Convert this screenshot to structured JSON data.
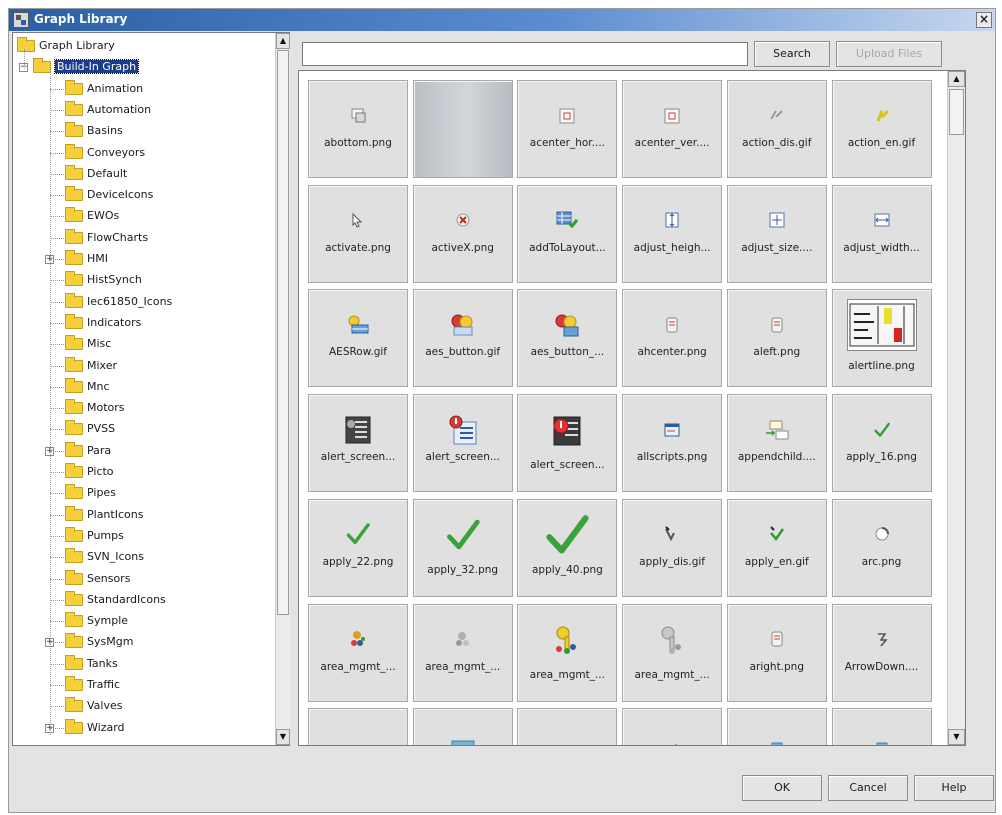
{
  "window": {
    "title": "Graph Library",
    "close_glyph": "×"
  },
  "tree": {
    "items": [
      {
        "label": "Graph Library",
        "depth": 0,
        "expander": "",
        "selected": false
      },
      {
        "label": "Build-In Graph",
        "depth": 1,
        "expander": "−",
        "selected": true
      },
      {
        "label": "Animation",
        "depth": 2,
        "expander": "",
        "selected": false
      },
      {
        "label": "Automation",
        "depth": 2,
        "expander": "",
        "selected": false
      },
      {
        "label": "Basins",
        "depth": 2,
        "expander": "",
        "selected": false
      },
      {
        "label": "Conveyors",
        "depth": 2,
        "expander": "",
        "selected": false
      },
      {
        "label": "Default",
        "depth": 2,
        "expander": "",
        "selected": false
      },
      {
        "label": "DeviceIcons",
        "depth": 2,
        "expander": "",
        "selected": false
      },
      {
        "label": "EWOs",
        "depth": 2,
        "expander": "",
        "selected": false
      },
      {
        "label": "FlowCharts",
        "depth": 2,
        "expander": "",
        "selected": false
      },
      {
        "label": "HMI",
        "depth": 2,
        "expander": "+",
        "selected": false
      },
      {
        "label": "HistSynch",
        "depth": 2,
        "expander": "",
        "selected": false
      },
      {
        "label": "Iec61850_Icons",
        "depth": 2,
        "expander": "",
        "selected": false
      },
      {
        "label": "Indicators",
        "depth": 2,
        "expander": "",
        "selected": false
      },
      {
        "label": "Misc",
        "depth": 2,
        "expander": "",
        "selected": false
      },
      {
        "label": "Mixer",
        "depth": 2,
        "expander": "",
        "selected": false
      },
      {
        "label": "Mnc",
        "depth": 2,
        "expander": "",
        "selected": false
      },
      {
        "label": "Motors",
        "depth": 2,
        "expander": "",
        "selected": false
      },
      {
        "label": "PVSS",
        "depth": 2,
        "expander": "",
        "selected": false
      },
      {
        "label": "Para",
        "depth": 2,
        "expander": "+",
        "selected": false
      },
      {
        "label": "Picto",
        "depth": 2,
        "expander": "",
        "selected": false
      },
      {
        "label": "Pipes",
        "depth": 2,
        "expander": "",
        "selected": false
      },
      {
        "label": "PlantIcons",
        "depth": 2,
        "expander": "",
        "selected": false
      },
      {
        "label": "Pumps",
        "depth": 2,
        "expander": "",
        "selected": false
      },
      {
        "label": "SVN_Icons",
        "depth": 2,
        "expander": "",
        "selected": false
      },
      {
        "label": "Sensors",
        "depth": 2,
        "expander": "",
        "selected": false
      },
      {
        "label": "StandardIcons",
        "depth": 2,
        "expander": "",
        "selected": false
      },
      {
        "label": "Symple",
        "depth": 2,
        "expander": "",
        "selected": false
      },
      {
        "label": "SysMgm",
        "depth": 2,
        "expander": "+",
        "selected": false
      },
      {
        "label": "Tanks",
        "depth": 2,
        "expander": "",
        "selected": false
      },
      {
        "label": "Traffic",
        "depth": 2,
        "expander": "",
        "selected": false
      },
      {
        "label": "Valves",
        "depth": 2,
        "expander": "",
        "selected": false
      },
      {
        "label": "Wizard",
        "depth": 2,
        "expander": "+",
        "selected": false
      }
    ]
  },
  "search": {
    "value": "",
    "placeholder": "",
    "button_label": "Search",
    "upload_label": "Upload Files"
  },
  "tiles": [
    {
      "label": "abottom.png",
      "icon": "align-bottom-icon"
    },
    {
      "label": "",
      "icon": "blank-gradient-image"
    },
    {
      "label": "acenter_hor....",
      "icon": "align-center-horizontal-icon"
    },
    {
      "label": "acenter_ver....",
      "icon": "align-center-vertical-icon"
    },
    {
      "label": "action_dis.gif",
      "icon": "action-disabled-icon"
    },
    {
      "label": "action_en.gif",
      "icon": "action-enabled-icon"
    },
    {
      "label": "activate.png",
      "icon": "cursor-arrow-icon"
    },
    {
      "label": "activeX.png",
      "icon": "activex-icon"
    },
    {
      "label": "addToLayout...",
      "icon": "add-to-layout-icon"
    },
    {
      "label": "adjust_heigh...",
      "icon": "adjust-height-icon"
    },
    {
      "label": "adjust_size....",
      "icon": "adjust-size-icon"
    },
    {
      "label": "adjust_width...",
      "icon": "adjust-width-icon"
    },
    {
      "label": "AESRow.gif",
      "icon": "aes-row-icon"
    },
    {
      "label": "aes_button.gif",
      "icon": "aes-button-icon"
    },
    {
      "label": "aes_button_...",
      "icon": "aes-button-alt-icon"
    },
    {
      "label": "ahcenter.png",
      "icon": "align-hcenter-icon"
    },
    {
      "label": "aleft.png",
      "icon": "align-left-icon"
    },
    {
      "label": "alertline.png",
      "icon": "alert-line-icon"
    },
    {
      "label": "alert_screen...",
      "icon": "alert-screen-icon"
    },
    {
      "label": "alert_screen...",
      "icon": "alert-screen-color-icon"
    },
    {
      "label": "alert_screen...",
      "icon": "alert-screen-red-icon"
    },
    {
      "label": "allscripts.png",
      "icon": "all-scripts-icon"
    },
    {
      "label": "appendchild....",
      "icon": "append-child-icon"
    },
    {
      "label": "apply_16.png",
      "icon": "checkmark-small-icon"
    },
    {
      "label": "apply_22.png",
      "icon": "checkmark-medium-icon"
    },
    {
      "label": "apply_32.png",
      "icon": "checkmark-large-icon"
    },
    {
      "label": "apply_40.png",
      "icon": "checkmark-xlarge-icon"
    },
    {
      "label": "apply_dis.gif",
      "icon": "apply-disabled-icon"
    },
    {
      "label": "apply_en.gif",
      "icon": "apply-enabled-icon"
    },
    {
      "label": "arc.png",
      "icon": "arc-icon"
    },
    {
      "label": "area_mgmt_...",
      "icon": "area-mgmt-icon"
    },
    {
      "label": "area_mgmt_...",
      "icon": "area-mgmt-disabled-icon"
    },
    {
      "label": "area_mgmt_...",
      "icon": "area-mgmt-key-icon"
    },
    {
      "label": "area_mgmt_...",
      "icon": "area-mgmt-key-disabled-icon"
    },
    {
      "label": "aright.png",
      "icon": "align-right-icon"
    },
    {
      "label": "ArrowDown....",
      "icon": "arrow-down-icon"
    },
    {
      "label": "",
      "icon": "partial-icon"
    },
    {
      "label": "",
      "icon": "partial-image-icon"
    },
    {
      "label": "",
      "icon": "partial-icon"
    },
    {
      "label": "",
      "icon": "partial-red-icon"
    },
    {
      "label": "",
      "icon": "partial-blue-icon"
    },
    {
      "label": "",
      "icon": "partial-blue-icon"
    }
  ],
  "footer": {
    "ok_label": "OK",
    "cancel_label": "Cancel",
    "help_label": "Help"
  },
  "colors": {
    "titlebar": "#2a5fa5",
    "selection": "#1b3d8c",
    "folder": "#f5cf3c",
    "tile_bg": "#e0e0e0"
  }
}
